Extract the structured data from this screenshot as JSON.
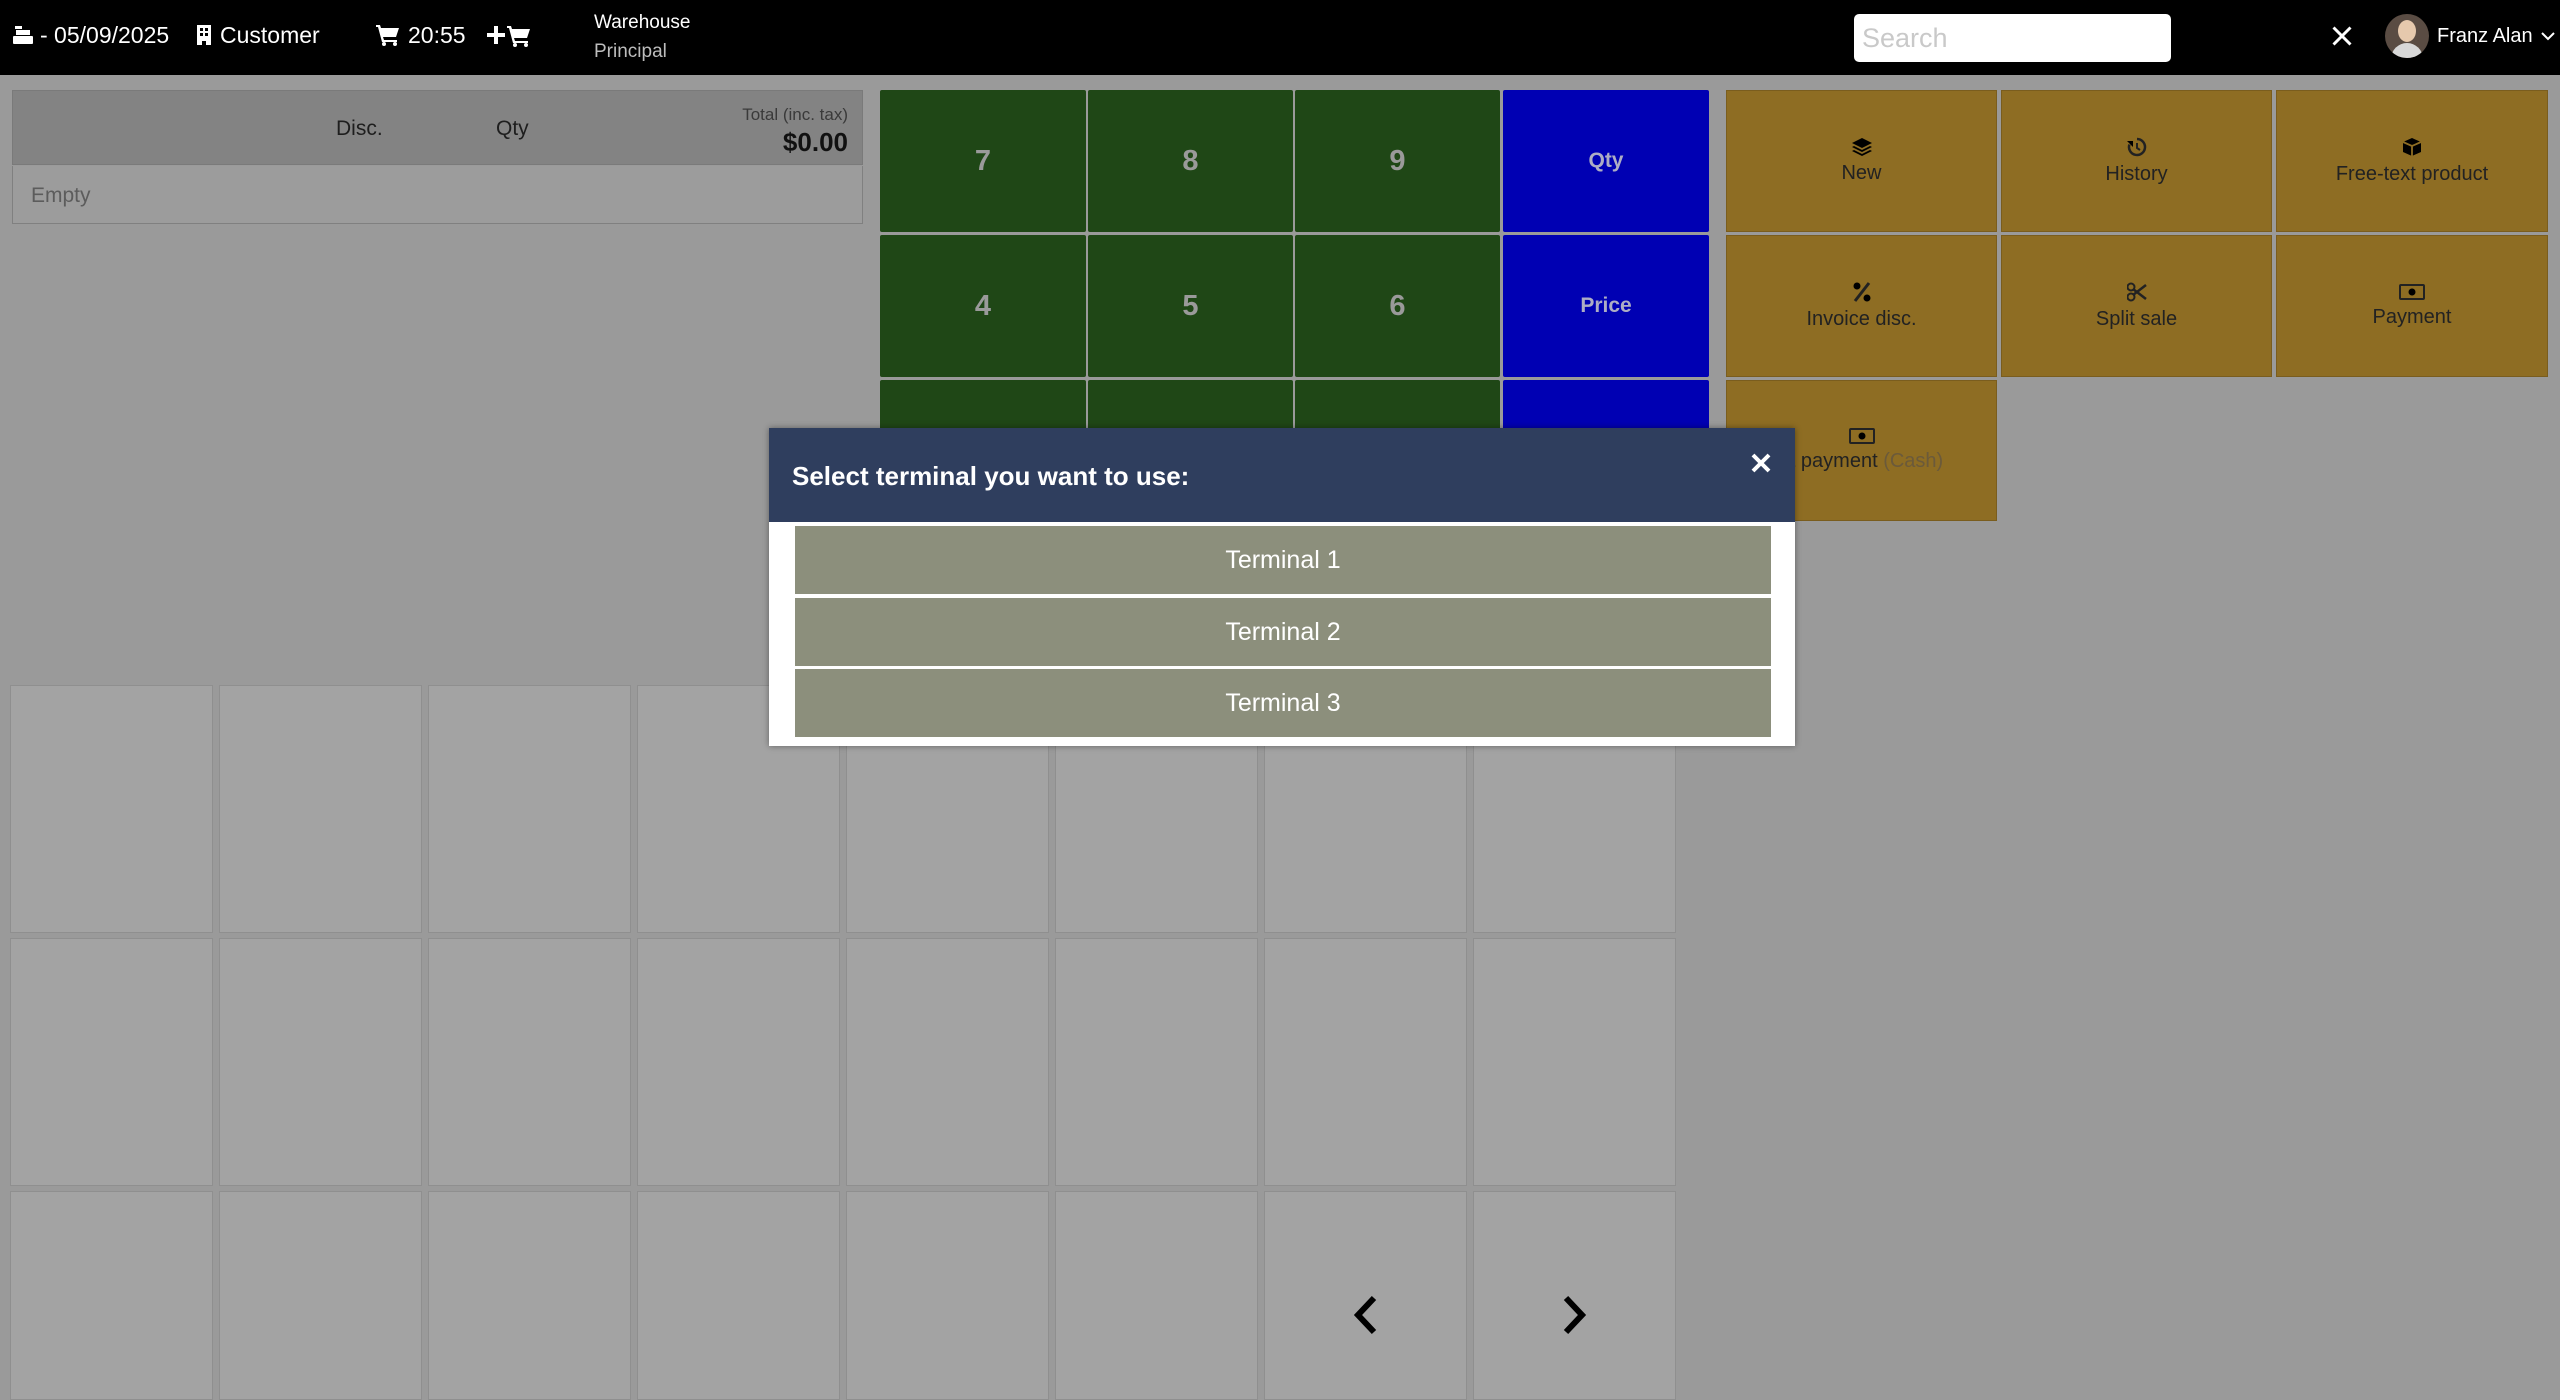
{
  "topbar": {
    "date": "- 05/09/2025",
    "customer": "Customer",
    "time": "20:55",
    "warehouse_label": "Warehouse",
    "warehouse_name": "Principal",
    "search_placeholder": "Search",
    "user_name": "Franz Alan"
  },
  "ticket": {
    "col_disc": "Disc.",
    "col_qty": "Qty",
    "total_label": "Total (inc. tax)",
    "total_value": "$0.00",
    "empty_text": "Empty"
  },
  "keypad": {
    "k7": "7",
    "k8": "8",
    "k9": "9",
    "k4": "4",
    "k5": "5",
    "k6": "6",
    "qty": "Qty",
    "price": "Price"
  },
  "actions": {
    "new": "New",
    "history": "History",
    "free_text": "Free-text product",
    "invoice_disc": "Invoice disc.",
    "split_sale": "Split sale",
    "payment": "Payment",
    "direct_payment": "ct payment",
    "direct_payment_method": "(Cash)"
  },
  "dialog": {
    "title": "Select terminal you want to use:",
    "terminals": [
      "Terminal 1",
      "Terminal 2",
      "Terminal 3"
    ]
  },
  "icons": {
    "date": "cash-register-icon",
    "customer": "building-icon",
    "time": "cart-icon",
    "new_cart": "add-cart-icon",
    "eraser": "backspace-icon",
    "home": "home-icon",
    "expand": "expand-icon",
    "user_menu": "chevron-down-icon",
    "close": "close-icon",
    "prev": "chevron-left-icon",
    "next": "chevron-right-icon"
  },
  "colors": {
    "keypad_numbers": "#1f4716",
    "keypad_functions": "#0000b3",
    "actions": "#8e6d23",
    "dialog_header": "#2f3e5e",
    "terminal_button": "#8c8f7c"
  }
}
